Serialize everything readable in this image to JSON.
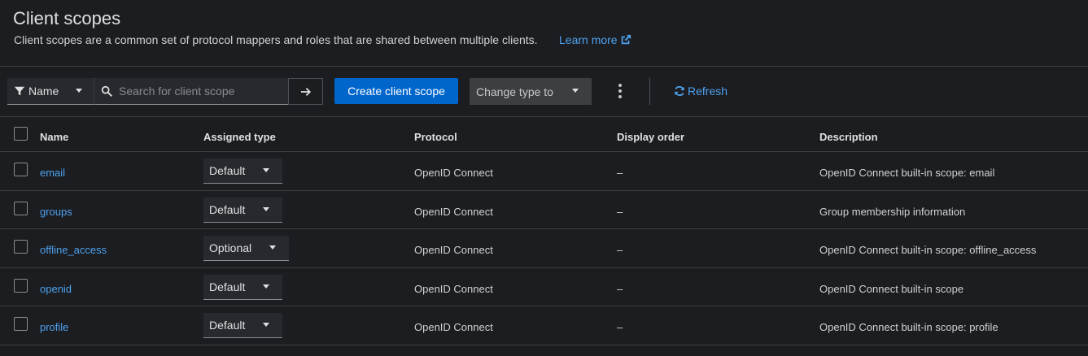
{
  "header": {
    "title": "Client scopes",
    "description": "Client scopes are a common set of protocol mappers and roles that are shared between multiple clients.",
    "learn_more": "Learn more"
  },
  "toolbar": {
    "filter_label": "Name",
    "search_placeholder": "Search for client scope",
    "create_label": "Create client scope",
    "change_type_label": "Change type to",
    "refresh_label": "Refresh"
  },
  "table": {
    "columns": [
      "Name",
      "Assigned type",
      "Protocol",
      "Display order",
      "Description"
    ],
    "rows": [
      {
        "name": "email",
        "type": "Default",
        "protocol": "OpenID Connect",
        "order": "–",
        "description": "OpenID Connect built-in scope: email"
      },
      {
        "name": "groups",
        "type": "Default",
        "protocol": "OpenID Connect",
        "order": "–",
        "description": "Group membership information"
      },
      {
        "name": "offline_access",
        "type": "Optional",
        "protocol": "OpenID Connect",
        "order": "–",
        "description": "OpenID Connect built-in scope: offline_access"
      },
      {
        "name": "openid",
        "type": "Default",
        "protocol": "OpenID Connect",
        "order": "–",
        "description": "OpenID Connect built-in scope"
      },
      {
        "name": "profile",
        "type": "Default",
        "protocol": "OpenID Connect",
        "order": "–",
        "description": "OpenID Connect built-in scope: profile"
      }
    ]
  },
  "icons": {
    "filter": "filter-icon",
    "search": "search-icon",
    "arrow": "arrow-right-icon",
    "external": "external-link-icon",
    "refresh": "refresh-icon",
    "kebab": "kebab-menu-icon"
  },
  "colors": {
    "background": "#1b1d21",
    "link": "#4fa2ee",
    "primary": "#0066cc",
    "border": "#3c3f42"
  }
}
